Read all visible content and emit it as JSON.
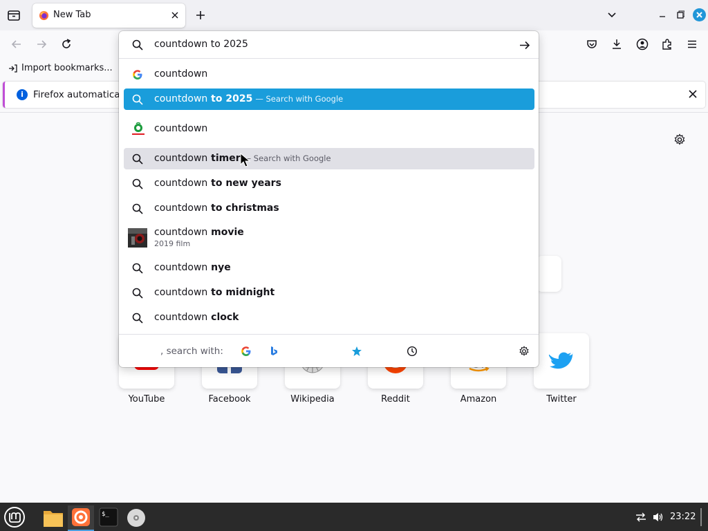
{
  "browser": {
    "tab": {
      "title": "New Tab"
    },
    "url_input": {
      "value": "countdown to 2025"
    }
  },
  "bookmarks": {
    "import_label": "Import bookmarks..."
  },
  "notification": {
    "text": "Firefox automatically"
  },
  "suggestions": [
    {
      "prefix": "countdown",
      "suffix": "",
      "action": "",
      "icon": "google-icon",
      "state": "normal"
    },
    {
      "prefix": "countdown",
      "suffix": " to 2025",
      "action": "— Search with Google",
      "icon": "search-icon",
      "state": "selected"
    },
    {
      "prefix": "countdown",
      "suffix": "",
      "action": "",
      "icon": "countdown-site-icon",
      "state": "normal"
    },
    {
      "prefix": "countdown",
      "suffix": " timer",
      "action": "— Search with Google",
      "icon": "search-icon",
      "state": "hover"
    },
    {
      "prefix": "countdown",
      "suffix": " to new years",
      "action": "",
      "icon": "search-icon",
      "state": "normal"
    },
    {
      "prefix": "countdown",
      "suffix": " to christmas",
      "action": "",
      "icon": "search-icon",
      "state": "normal"
    },
    {
      "prefix": "countdown",
      "suffix": " movie",
      "action": "",
      "sub": "2019 film",
      "icon": "movie-thumbnail",
      "state": "normal"
    },
    {
      "prefix": "countdown",
      "suffix": " nye",
      "action": "",
      "icon": "search-icon",
      "state": "normal"
    },
    {
      "prefix": "countdown",
      "suffix": " to midnight",
      "action": "",
      "icon": "search-icon",
      "state": "normal"
    },
    {
      "prefix": "countdown",
      "suffix": " clock",
      "action": "",
      "icon": "search-icon",
      "state": "normal"
    }
  ],
  "oneoff": {
    "label": ", search with:"
  },
  "top_sites": [
    {
      "name": "YouTube",
      "icon": "youtube-icon"
    },
    {
      "name": "Facebook",
      "icon": "facebook-icon"
    },
    {
      "name": "Wikipedia",
      "icon": "wikipedia-icon"
    },
    {
      "name": "Reddit",
      "icon": "reddit-icon"
    },
    {
      "name": "Amazon",
      "icon": "amazon-icon"
    },
    {
      "name": "Twitter",
      "icon": "twitter-icon"
    }
  ],
  "taskbar": {
    "time": "23:22"
  },
  "colors": {
    "selected": "#1a9ddb",
    "accent": "#0060df",
    "taskbar": "#2a2a2a"
  }
}
